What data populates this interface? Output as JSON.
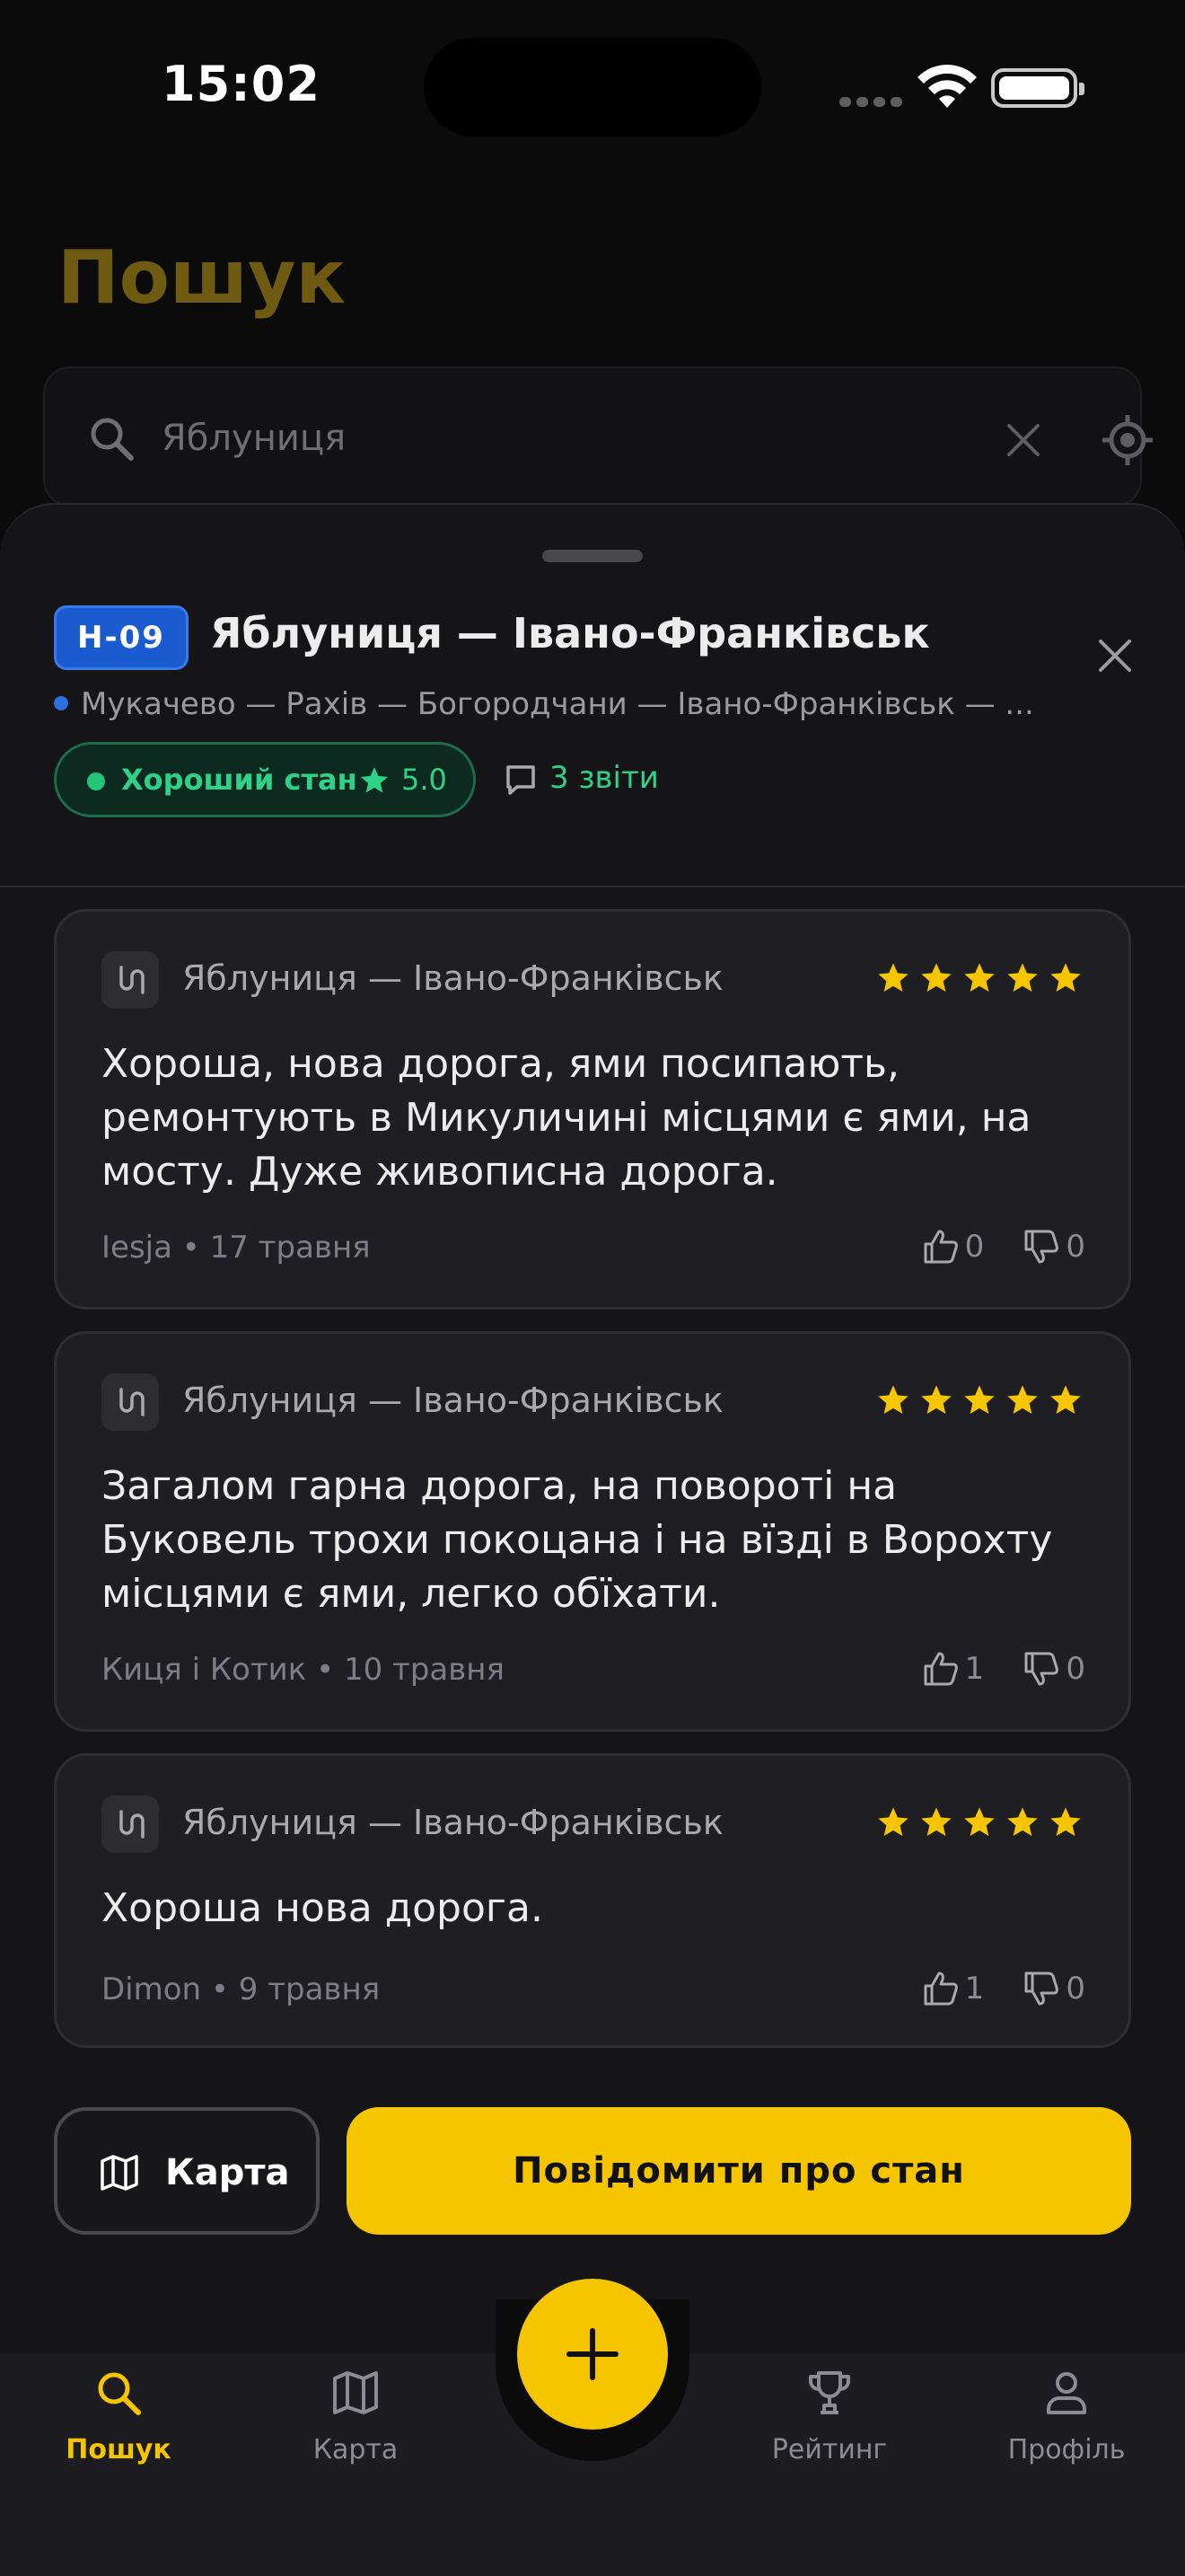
{
  "status_bar": {
    "time": "15:02"
  },
  "page": {
    "title": "Пошук"
  },
  "search": {
    "value": "Яблуниця",
    "placeholder": "Яблуниця"
  },
  "sheet": {
    "road_code": "Н-09",
    "title": "Яблуниця — Івано-Франківськ",
    "route": "Мукачево — Рахів — Богородчани — Івано-Франківськ — ...",
    "status_label": "Хороший стан",
    "rating": "5.0",
    "reports_label": "3 звіти"
  },
  "reviews": [
    {
      "road": "Яблуниця — Івано-Франківськ",
      "stars": 5,
      "text": "Хороша, нова дорога, ями посипають, ремонтують в Микуличині місцями є ями, на мосту. Дуже живописна дорога.",
      "meta": "Iesja • 17 травня",
      "likes": "0",
      "dislikes": "0"
    },
    {
      "road": "Яблуниця — Івано-Франківськ",
      "stars": 5,
      "text": "Загалом гарна дорога, на повороті на Буковель трохи покоцана і на вїзді в Ворохту місцями є ями, легко обїхати.",
      "meta": "Киця і Котик • 10 травня",
      "likes": "1",
      "dislikes": "0"
    },
    {
      "road": "Яблуниця — Івано-Франківськ",
      "stars": 5,
      "text": "Хороша нова дорога.",
      "meta": "Dimon • 9 травня",
      "likes": "1",
      "dislikes": "0"
    }
  ],
  "actions": {
    "map_label": "Карта",
    "report_label": "Повідомити про стан"
  },
  "tabs": [
    {
      "label": "Пошук",
      "icon": "search-icon",
      "active": true
    },
    {
      "label": "Карта",
      "icon": "map-icon",
      "active": false
    },
    {
      "label": "Рейтинг",
      "icon": "trophy-icon",
      "active": false
    },
    {
      "label": "Профіль",
      "icon": "profile-icon",
      "active": false
    }
  ],
  "colors": {
    "accent": "#f5c600",
    "good": "#2fd189",
    "road_badge": "#1a5bd0",
    "background": "#0b0b0c"
  }
}
